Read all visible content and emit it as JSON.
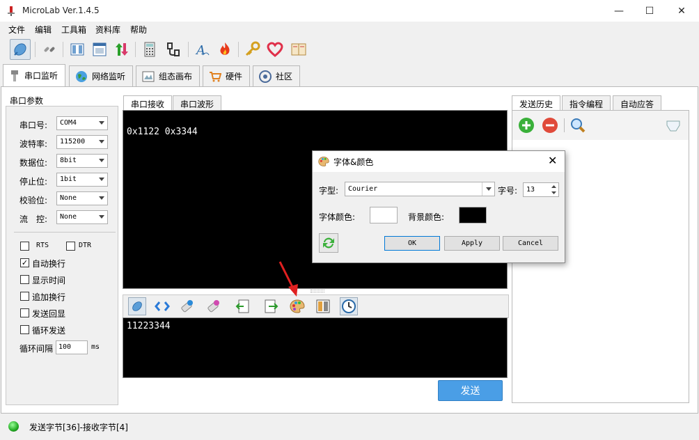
{
  "window": {
    "title": "MicroLab Ver.1.4.5",
    "minimize": "—",
    "maximize": "☐",
    "close": "✕"
  },
  "menu": [
    "文件",
    "编辑",
    "工具箱",
    "资料库",
    "帮助"
  ],
  "toolbar_icons": [
    "serial-connect-icon",
    "network-link-icon",
    "columns-icon",
    "window-icon",
    "up-down-arrows-icon",
    "calculator-icon",
    "cable-icon",
    "font-icon",
    "flame-icon",
    "key-icon",
    "heart-icon",
    "book-icon"
  ],
  "main_tabs": [
    {
      "label": "串口监听",
      "icon": "serial-plug-icon",
      "active": true
    },
    {
      "label": "网络监听",
      "icon": "globe-icon",
      "active": false
    },
    {
      "label": "组态画布",
      "icon": "canvas-icon",
      "active": false
    },
    {
      "label": "硬件",
      "icon": "cart-icon",
      "active": false
    },
    {
      "label": "社区",
      "icon": "community-icon",
      "active": false
    }
  ],
  "serial_params": {
    "group_title": "串口参数",
    "port_label": "串口号:",
    "port_value": "COM4",
    "baud_label": "波特率:",
    "baud_value": "115200",
    "databits_label": "数据位:",
    "databits_value": "8bit",
    "stopbits_label": "停止位:",
    "stopbits_value": "1bit",
    "parity_label": "校验位:",
    "parity_value": "None",
    "flow_label": "流　控:",
    "flow_value": "None"
  },
  "options": {
    "rts": "RTS",
    "dtr": "DTR",
    "auto_wrap": "自动换行",
    "show_time": "显示时间",
    "append_wrap": "追加换行",
    "send_echo": "发送回显",
    "loop_send": "循环发送",
    "loop_interval_label": "循环间隔",
    "loop_interval_value": "100",
    "loop_interval_unit": "ms",
    "checked_mark": "✓"
  },
  "center_tabs": [
    "串口接收",
    "串口波形"
  ],
  "receive_text": "0x1122 0x3344",
  "send_text": "11223344",
  "send_button": "发送",
  "right_tabs": [
    "发送历史",
    "指令编程",
    "自动应答"
  ],
  "status": {
    "text": "发送字节[36]-接收字节[4]",
    "led_color": "#2fae2f"
  },
  "dialog": {
    "title": "字体&颜色",
    "font_label": "字型:",
    "font_value": "Courier",
    "size_label": "字号:",
    "size_value": "13",
    "font_color_label": "字体颜色:",
    "bg_color_label": "背景颜色:",
    "font_color": "#ffffff",
    "bg_color": "#000000",
    "ok": "OK",
    "apply": "Apply",
    "cancel": "Cancel",
    "close": "✕"
  },
  "colors": {
    "send_button": "#4a9ee6",
    "terminal_bg": "#000000",
    "terminal_fg": "#ffffff",
    "annotation_arrow": "#e02020"
  }
}
